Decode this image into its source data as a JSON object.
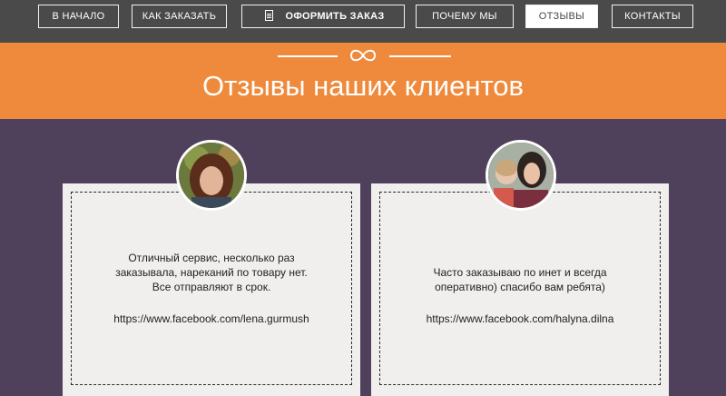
{
  "nav": {
    "home": "В НАЧАЛО",
    "how_to_order": "КАК ЗАКАЗАТЬ",
    "place_order": "ОФОРМИТЬ ЗАКАЗ",
    "why_us": "ПОЧЕМУ МЫ",
    "reviews": "ОТЗЫВЫ",
    "contacts": "КОНТАКТЫ",
    "active": "reviews"
  },
  "banner": {
    "title": "Отзывы наших клиентов",
    "icon": "infinity-icon"
  },
  "reviews": [
    {
      "lines": [
        "Отличный сервис, несколько раз",
        "заказывала, нареканий по товару нет.",
        "Все отправляют в срок."
      ],
      "link": "https://www.facebook.com/lena.gurmush"
    },
    {
      "lines": [
        "Часто заказываю по инет и всегда",
        "оперативно) спасибо вам ребята)"
      ],
      "link": "https://www.facebook.com/halyna.dilna"
    }
  ],
  "colors": {
    "nav_bg": "#4a4a4a",
    "banner": "#ef8a3c",
    "page_bg": "#4f415c",
    "card": "#f1efed"
  }
}
